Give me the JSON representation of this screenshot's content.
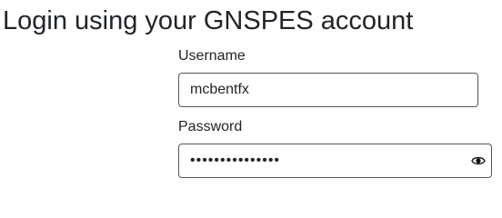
{
  "heading": "Login using your GNSPES account",
  "form": {
    "username": {
      "label": "Username",
      "value": "mcbentfx"
    },
    "password": {
      "label": "Password",
      "value": "•••••••••••••••",
      "toggle_icon": "eye-icon"
    }
  }
}
